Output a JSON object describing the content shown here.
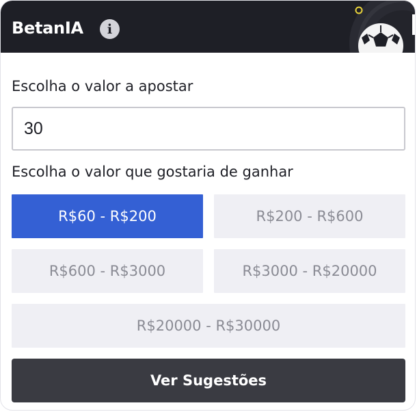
{
  "header": {
    "brand": "BetanIA",
    "info_glyph": "i"
  },
  "bet": {
    "label": "Escolha o valor a apostar",
    "value": "30"
  },
  "win": {
    "label": "Escolha o valor que gostaria de ganhar",
    "options": [
      {
        "label": "R$60 - R$200",
        "selected": true
      },
      {
        "label": "R$200 - R$600",
        "selected": false
      },
      {
        "label": "R$600 - R$3000",
        "selected": false
      },
      {
        "label": "R$3000 - R$20000",
        "selected": false
      },
      {
        "label": "R$20000 - R$30000",
        "selected": false
      }
    ]
  },
  "cta": {
    "label": "Ver Sugestões"
  },
  "colors": {
    "header_bg": "#1e1f26",
    "accent": "#3460d4",
    "option_bg": "#efeff4",
    "cta_bg": "#3a3b42",
    "deco_dot_blue": "#4aa8e0",
    "deco_dot_yellow": "#e8d23a"
  },
  "icons": [
    "info-icon",
    "soccer-ball-icon"
  ]
}
